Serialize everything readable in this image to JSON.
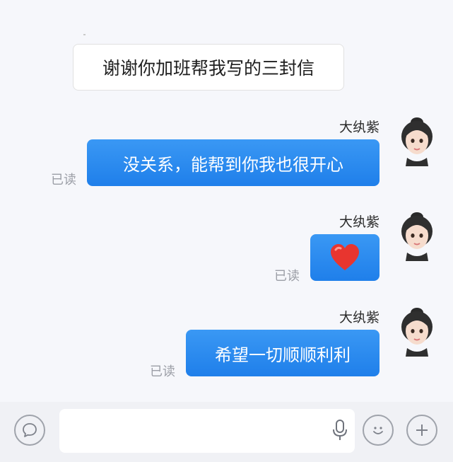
{
  "messages": [
    {
      "side": "left",
      "text": "谢谢你加班帮我写的三封信"
    },
    {
      "side": "right",
      "sender": "大纨紫",
      "text": "没关系，能帮到你我也很开心",
      "status": "已读"
    },
    {
      "side": "right",
      "sender": "大纨紫",
      "text": "",
      "icon": "red-heart-icon",
      "status": "已读"
    },
    {
      "side": "right",
      "sender": "大纨紫",
      "text": "希望一切顺顺利利",
      "status": "已读"
    }
  ],
  "input": {
    "value": "",
    "placeholder": ""
  },
  "icons": {
    "left": "chat-bubble-icon",
    "mic": "microphone-icon",
    "emoji": "smiley-icon",
    "plus": "plus-icon"
  },
  "colors": {
    "bubble": "#2b8cf0",
    "read": "#9b9ea6",
    "heart": "#e8352f"
  }
}
